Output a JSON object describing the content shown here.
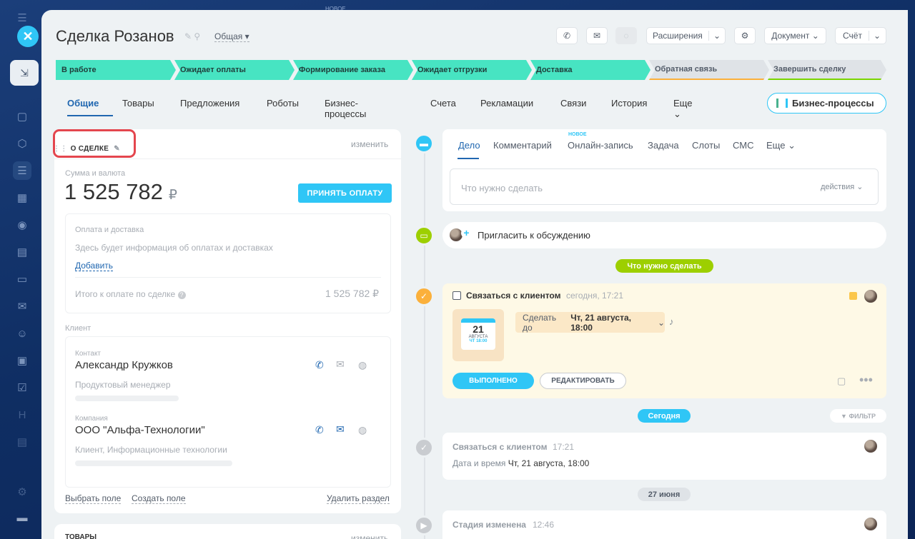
{
  "top_new": "НОВОЕ",
  "deal": {
    "title": "Сделка Розанов",
    "category": "Общая"
  },
  "header": {
    "extensions": "Расширения",
    "document": "Документ",
    "invoice": "Счёт"
  },
  "stages": [
    {
      "label": "В работе",
      "color": "#47e4c2"
    },
    {
      "label": "Ожидает оплаты",
      "color": "#47e4c2"
    },
    {
      "label": "Формирование заказа",
      "color": "#47e4c2"
    },
    {
      "label": "Ожидает отгрузки",
      "color": "#47e4c2"
    },
    {
      "label": "Доставка",
      "color": "#47e4c2"
    },
    {
      "label": "Обратная связь",
      "color": "#dfe3e7"
    },
    {
      "label": "Завершить сделку",
      "color": "#dfe3e7"
    }
  ],
  "tabs": [
    "Общие",
    "Товары",
    "Предложения",
    "Роботы",
    "Бизнес-процессы",
    "Счета",
    "Рекламации",
    "Связи",
    "История",
    "Еще"
  ],
  "bp_button": "Бизнес-процессы",
  "about": {
    "title": "О СДЕЛКЕ",
    "change": "изменить",
    "sum_label": "Сумма и валюта",
    "sum": "1 525 782",
    "currency": "₽",
    "pay_button": "ПРИНЯТЬ ОПЛАТУ",
    "payment_title": "Оплата и доставка",
    "payment_info": "Здесь будет информация об оплатах и доставках",
    "add": "Добавить",
    "total_label": "Итого к оплате по сделке",
    "total": "1 525 782 ₽",
    "client_label": "Клиент",
    "contact_label": "Контакт",
    "contact_name": "Александр Кружков",
    "contact_role": "Продуктовый менеджер",
    "company_label": "Компания",
    "company_name": "ООО \"Альфа-Технологии\"",
    "company_info": "Клиент, Информационные технологии",
    "select_field": "Выбрать поле",
    "create_field": "Создать поле",
    "delete_section": "Удалить раздел"
  },
  "products_section": {
    "title": "ТОВАРЫ",
    "change": "изменить"
  },
  "activity_tabs": [
    "Дело",
    "Комментарий",
    "Онлайн-запись",
    "Задача",
    "Слоты",
    "СМС",
    "Еще"
  ],
  "new_badge": "НОВОЕ",
  "todo": {
    "placeholder": "Что нужно сделать",
    "actions": "действия"
  },
  "invite": "Пригласить к обсуждению",
  "todo_pill": "Что нужно сделать",
  "task": {
    "title": "Связаться с клиентом",
    "time": "сегодня, 17:21",
    "cal_day": "21",
    "cal_month": "АВГУСТА",
    "cal_sub": "ЧТ 18:00",
    "deadline_prefix": "Сделать до",
    "deadline": "Чт, 21 августа, 18:00",
    "done": "ВЫПОЛНЕНО",
    "edit": "РЕДАКТИРОВАТЬ"
  },
  "today": "Сегодня",
  "filter": "ФИЛЬТР",
  "history": [
    {
      "title": "Связаться с клиентом",
      "time": "17:21",
      "line_label": "Дата и время",
      "line_value": "Чт, 21 августа, 18:00"
    }
  ],
  "date_pill": "27 июня",
  "stage_changed": {
    "title": "Стадия изменена",
    "time": "12:46"
  }
}
